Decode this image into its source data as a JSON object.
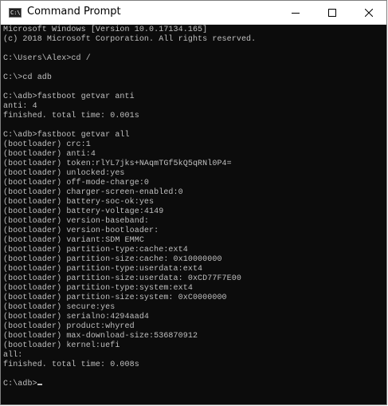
{
  "window": {
    "title": "Command Prompt",
    "icon_text": "C:\\"
  },
  "controls": {
    "minimize": "minimize-icon",
    "maximize": "maximize-icon",
    "close": "close-icon"
  },
  "terminal": {
    "lines": [
      "Microsoft Windows [Version 10.0.17134.165]",
      "(c) 2018 Microsoft Corporation. All rights reserved.",
      "",
      "C:\\Users\\Alex>cd /",
      "",
      "C:\\>cd adb",
      "",
      "C:\\adb>fastboot getvar anti",
      "anti: 4",
      "finished. total time: 0.001s",
      "",
      "C:\\adb>fastboot getvar all",
      "(bootloader) crc:1",
      "(bootloader) anti:4",
      "(bootloader) token:rlYL7jks+NAqmTGf5kQ5qRNl0P4=",
      "(bootloader) unlocked:yes",
      "(bootloader) off-mode-charge:0",
      "(bootloader) charger-screen-enabled:0",
      "(bootloader) battery-soc-ok:yes",
      "(bootloader) battery-voltage:4149",
      "(bootloader) version-baseband:",
      "(bootloader) version-bootloader:",
      "(bootloader) variant:SDM EMMC",
      "(bootloader) partition-type:cache:ext4",
      "(bootloader) partition-size:cache: 0x10000000",
      "(bootloader) partition-type:userdata:ext4",
      "(bootloader) partition-size:userdata: 0xCD77F7E00",
      "(bootloader) partition-type:system:ext4",
      "(bootloader) partition-size:system: 0xC0000000",
      "(bootloader) secure:yes",
      "(bootloader) serialno:4294aad4",
      "(bootloader) product:whyred",
      "(bootloader) max-download-size:536870912",
      "(bootloader) kernel:uefi",
      "all:",
      "finished. total time: 0.008s",
      "",
      "C:\\adb>"
    ]
  }
}
